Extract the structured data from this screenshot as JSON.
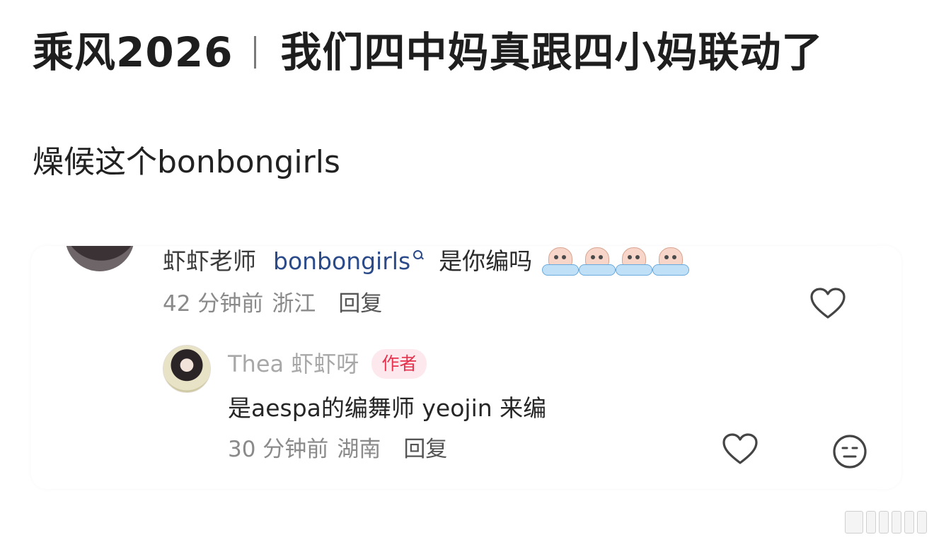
{
  "post": {
    "title_left": "乘风2026",
    "title_right": "我们四中妈真跟四小妈联动了",
    "body": "燥候这个bonbongirls"
  },
  "comment": {
    "username": "虾虾老师",
    "mention": "bonbongirls",
    "text": "是你编吗",
    "emojis": [
      "crying-emoji",
      "crying-emoji",
      "crying-emoji",
      "crying-emoji"
    ],
    "time": "42 分钟前",
    "location": "浙江",
    "reply_label": "回复",
    "reply": {
      "username": "Thea 虾虾呀",
      "badge": "作者",
      "text": "是aespa的编舞师 yeojin 来编",
      "time": "30 分钟前",
      "location": "湖南",
      "reply_label": "回复"
    }
  },
  "colors": {
    "mention": "#2b4a8a",
    "badge_text": "#e5334f",
    "badge_bg": "#fde9ed",
    "meta": "#8a8a8a"
  },
  "icons": [
    "search-icon",
    "heart-outline-icon",
    "neutral-face-icon",
    "watermark-logo"
  ]
}
